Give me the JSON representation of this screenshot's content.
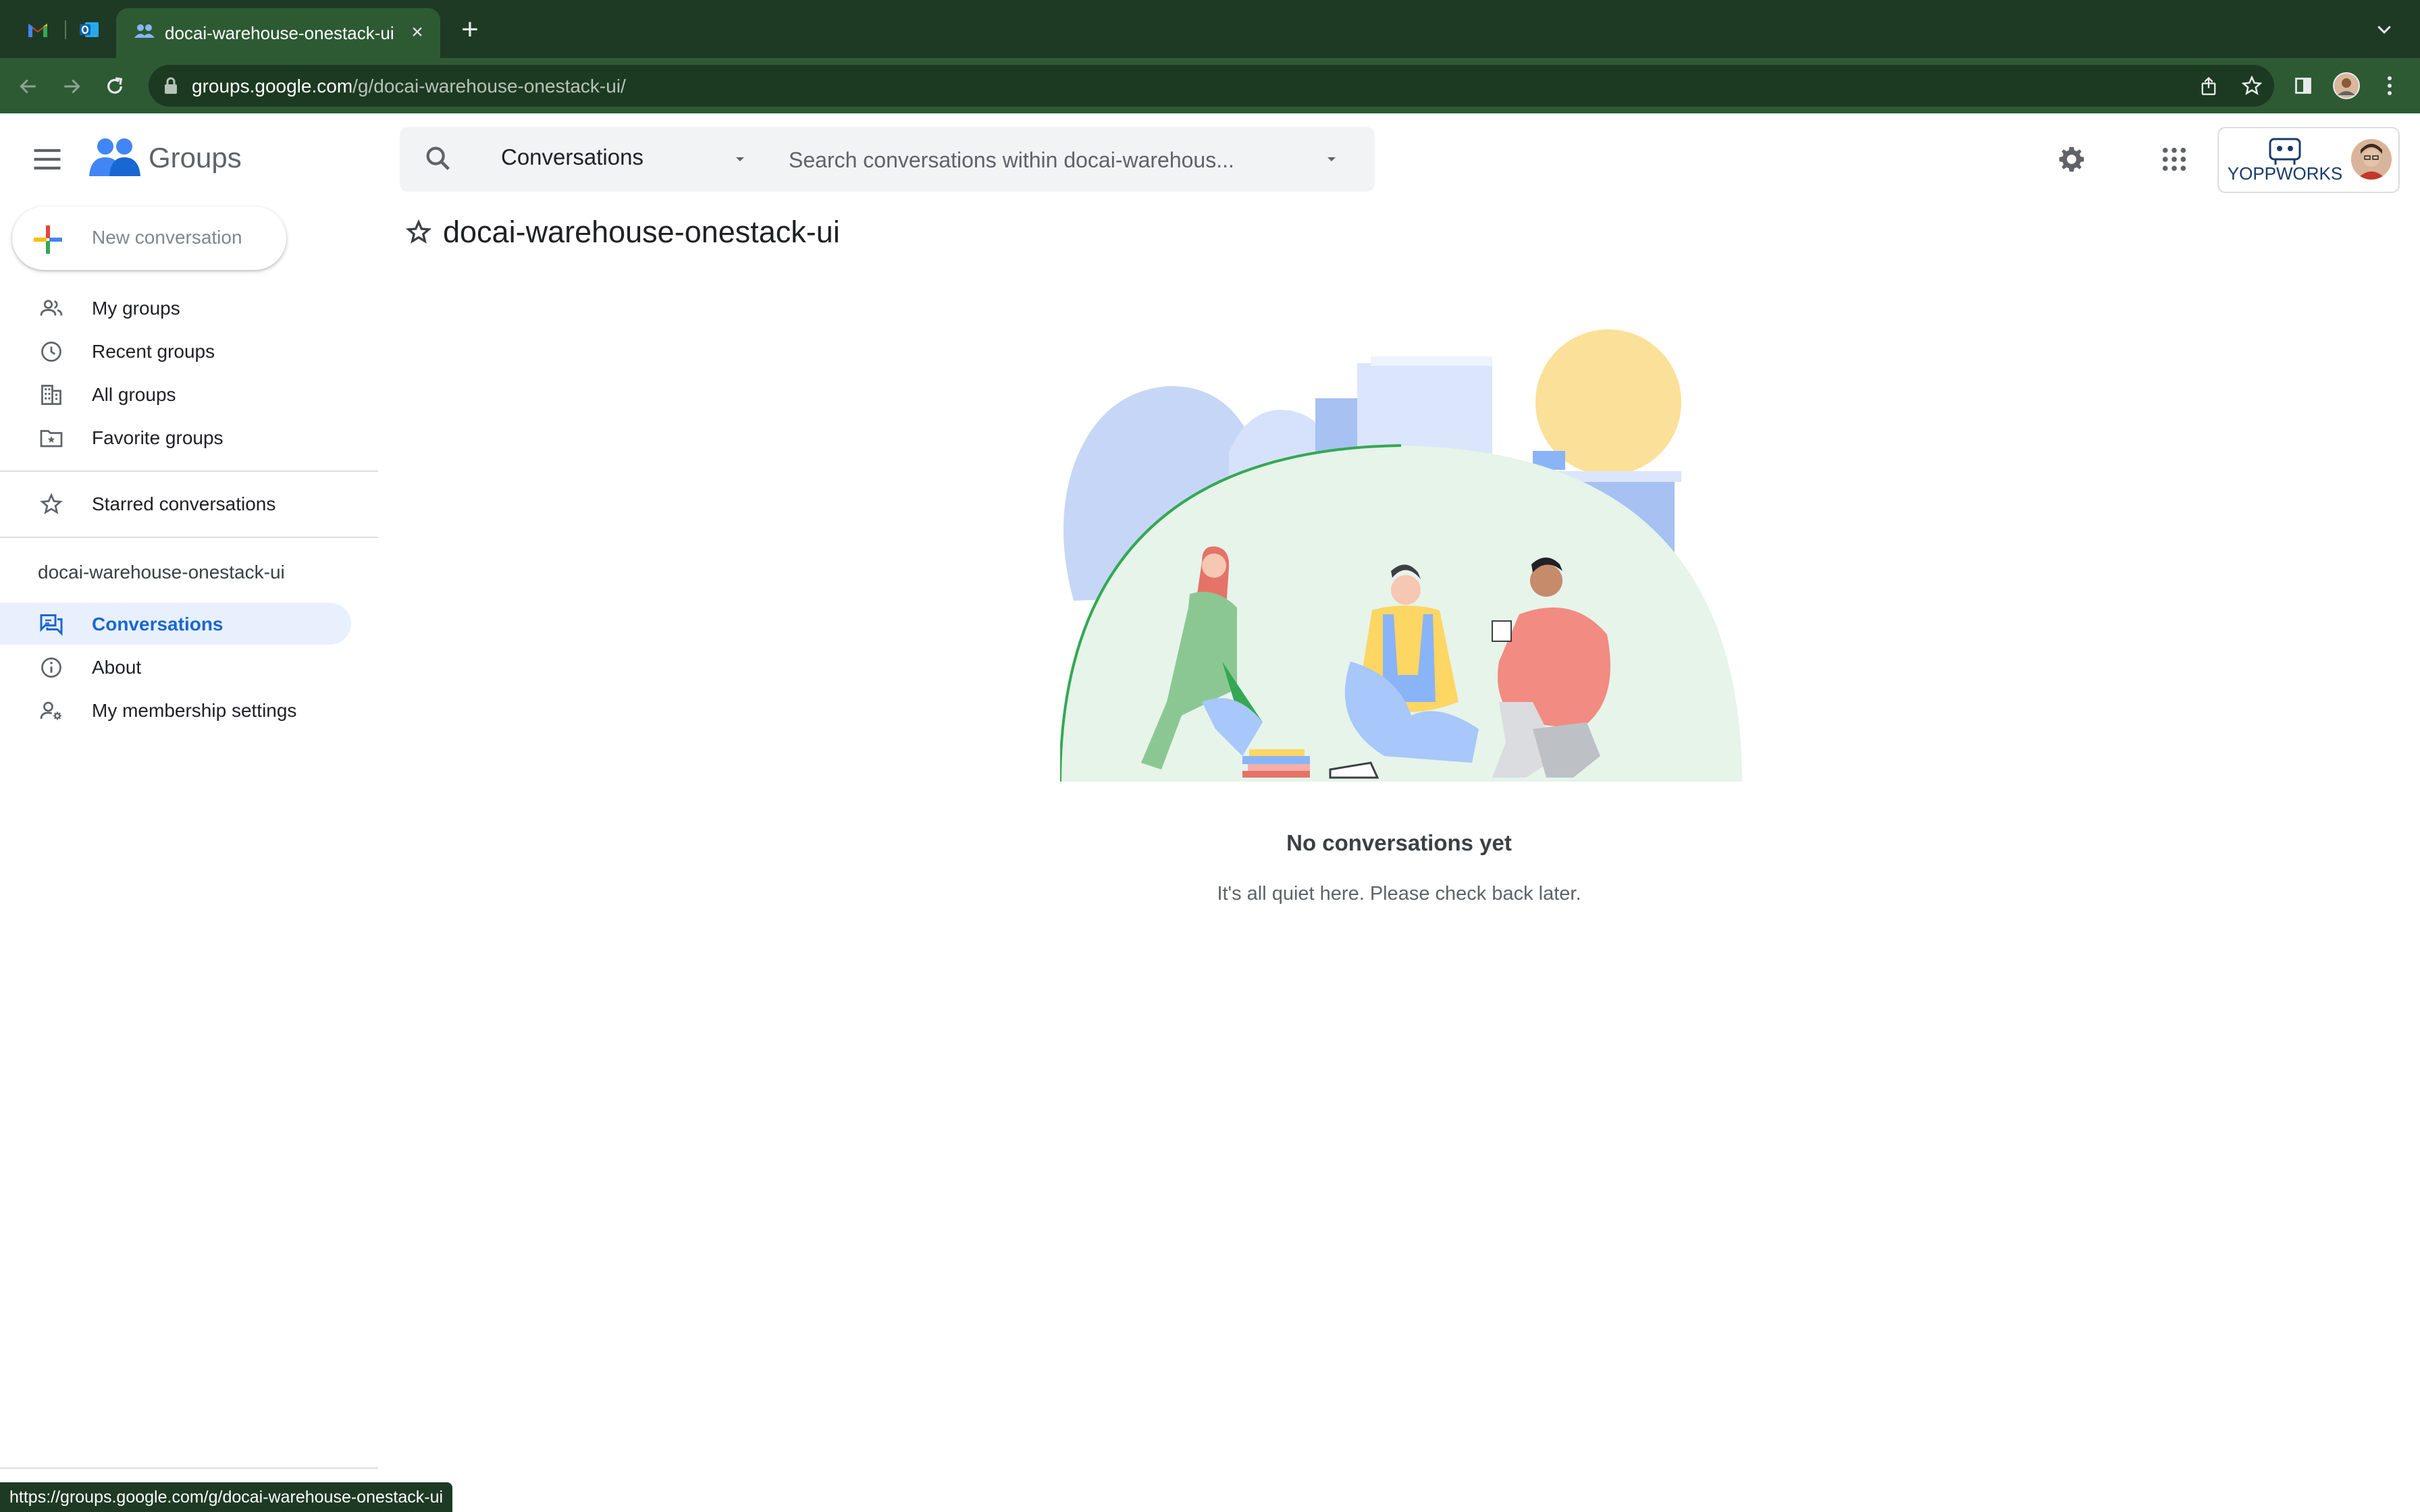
{
  "browser": {
    "tabs": [
      {
        "icon": "gmail-icon"
      },
      {
        "icon": "outlook-icon"
      },
      {
        "icon": "groups-icon",
        "title": "docai-warehouse-onestack-ui",
        "active": true
      }
    ],
    "url": {
      "host": "groups.google.com",
      "path": "/g/docai-warehouse-onestack-ui/"
    },
    "status_url": "https://groups.google.com/g/docai-warehouse-onestack-ui"
  },
  "app": {
    "name": "Groups",
    "search": {
      "scope": "Conversations",
      "placeholder": "Search conversations within docai-warehous..."
    },
    "account": {
      "org": "YOPPWORKS"
    }
  },
  "sidebar": {
    "new_conversation": "New conversation",
    "nav": [
      {
        "label": "My groups",
        "icon": "people-icon"
      },
      {
        "label": "Recent groups",
        "icon": "clock-icon"
      },
      {
        "label": "All groups",
        "icon": "building-icon"
      },
      {
        "label": "Favorite groups",
        "icon": "folder-star-icon"
      }
    ],
    "starred": {
      "label": "Starred conversations",
      "icon": "star-icon"
    },
    "group_name": "docai-warehouse-onestack-ui",
    "group_nav": [
      {
        "label": "Conversations",
        "icon": "conversations-icon",
        "active": true
      },
      {
        "label": "About",
        "icon": "info-icon"
      },
      {
        "label": "My membership settings",
        "icon": "person-settings-icon"
      }
    ]
  },
  "main": {
    "title": "docai-warehouse-onestack-ui",
    "empty_title": "No conversations yet",
    "empty_subtitle": "It's all quiet here. Please check back later."
  },
  "colors": {
    "accent": "#1967d2",
    "active_bg": "#e8f0fe",
    "chrome_dark": "#1f3a24",
    "chrome_toolbar": "#2d5a33"
  }
}
